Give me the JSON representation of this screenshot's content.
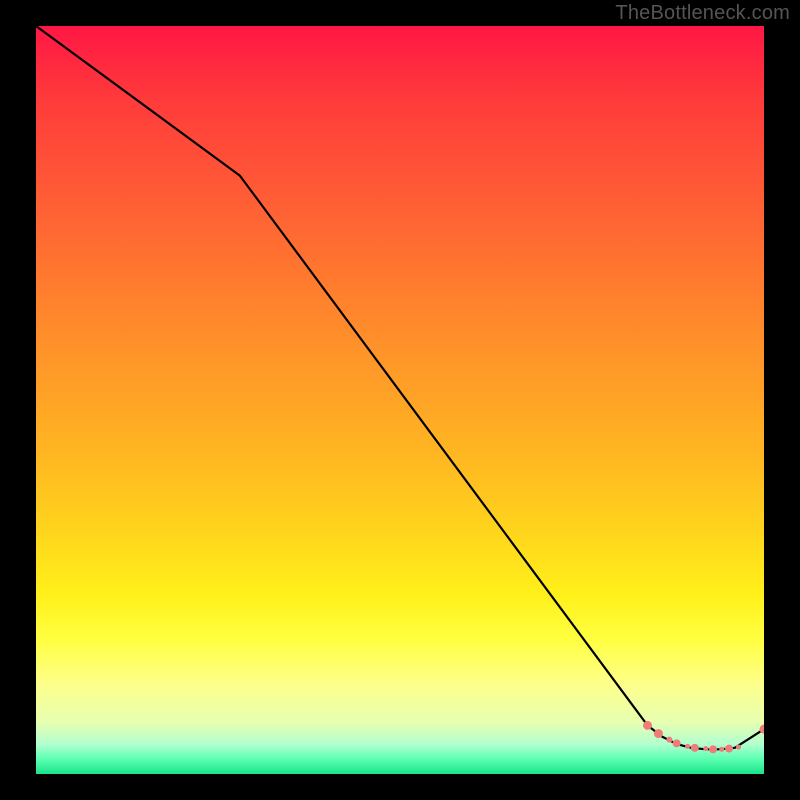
{
  "watermark": "TheBottleneck.com",
  "chart_data": {
    "type": "line",
    "title": "",
    "xlabel": "",
    "ylabel": "",
    "xlim": [
      0,
      100
    ],
    "ylim": [
      0,
      100
    ],
    "grid": false,
    "legend": false,
    "series": [
      {
        "name": "curve",
        "color": "#000000",
        "x": [
          0,
          28,
          84,
          86,
          88,
          90,
          92,
          94,
          96,
          100
        ],
        "y": [
          100,
          80,
          6.5,
          5.0,
          4.0,
          3.5,
          3.3,
          3.3,
          3.5,
          6.0
        ]
      }
    ],
    "markers": {
      "name": "highlight-points",
      "color": "#ef7c79",
      "points": [
        {
          "x": 84.0,
          "y": 6.5,
          "r": 4.5
        },
        {
          "x": 85.5,
          "y": 5.4,
          "r": 4.5
        },
        {
          "x": 87.0,
          "y": 4.6,
          "r": 3.0
        },
        {
          "x": 88.0,
          "y": 4.1,
          "r": 4.0
        },
        {
          "x": 89.5,
          "y": 3.7,
          "r": 2.5
        },
        {
          "x": 90.5,
          "y": 3.5,
          "r": 4.0
        },
        {
          "x": 92.0,
          "y": 3.4,
          "r": 2.5
        },
        {
          "x": 93.0,
          "y": 3.3,
          "r": 4.0
        },
        {
          "x": 94.2,
          "y": 3.3,
          "r": 2.5
        },
        {
          "x": 95.2,
          "y": 3.4,
          "r": 4.0
        },
        {
          "x": 96.5,
          "y": 3.6,
          "r": 2.5
        },
        {
          "x": 100.0,
          "y": 6.0,
          "r": 4.5
        }
      ]
    }
  }
}
